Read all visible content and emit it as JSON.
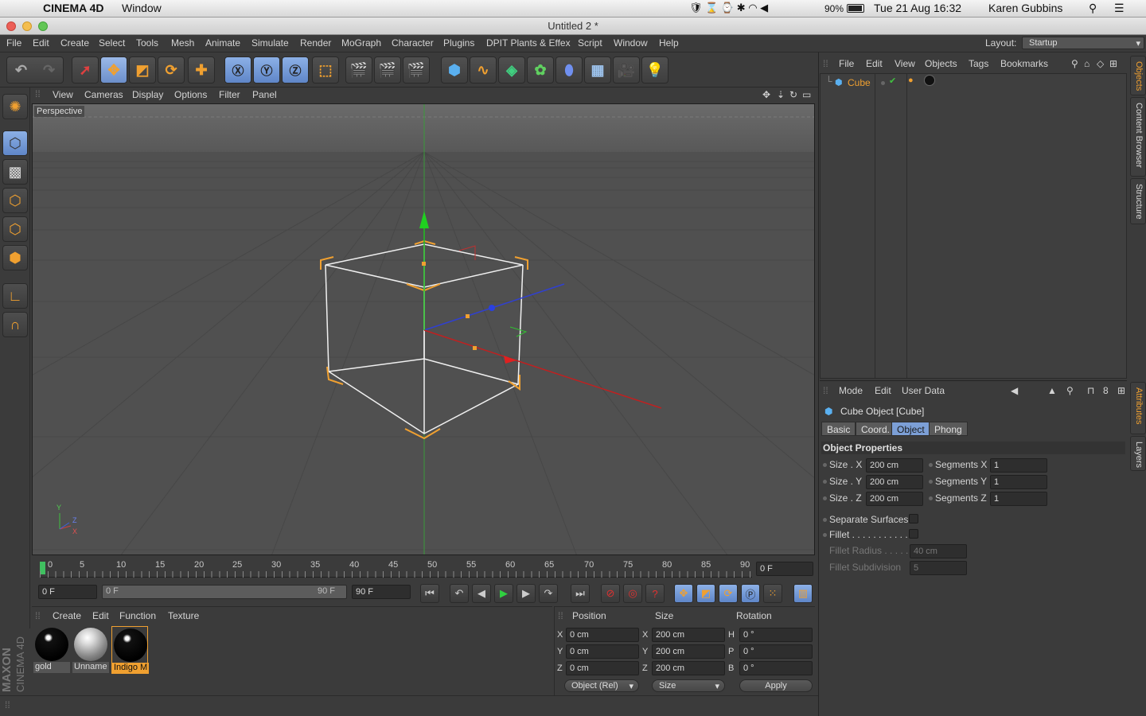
{
  "mac": {
    "app": "CINEMA 4D",
    "window_menu": "Window",
    "battery": "90%",
    "datetime": "Tue 21 Aug  16:32",
    "user": "Karen Gubbins"
  },
  "window": {
    "title": "Untitled 2 *"
  },
  "menus": [
    "File",
    "Edit",
    "Create",
    "Select",
    "Tools",
    "Mesh",
    "Animate",
    "Simulate",
    "Render",
    "MoGraph",
    "Character",
    "Plugins",
    "DPIT Plants & Effex",
    "Script",
    "Window",
    "Help"
  ],
  "layout": {
    "label": "Layout:",
    "value": "Startup"
  },
  "viewport": {
    "menus": [
      "View",
      "Cameras",
      "Display",
      "Options",
      "Filter",
      "Panel"
    ],
    "label": "Perspective",
    "axis_y": "Y",
    "axis_z": "Z",
    "axis_x": "X"
  },
  "timeline": {
    "ticks": [
      "0",
      "5",
      "10",
      "15",
      "20",
      "25",
      "30",
      "35",
      "40",
      "45",
      "50",
      "55",
      "60",
      "65",
      "70",
      "75",
      "80",
      "85",
      "90"
    ],
    "current": "0 F",
    "start": "0 F",
    "range_start": "0 F",
    "range_end": "90 F",
    "end": "90 F"
  },
  "materials": {
    "menus": [
      "Create",
      "Edit",
      "Function",
      "Texture"
    ],
    "items": [
      {
        "name": "gold"
      },
      {
        "name": "Unname"
      },
      {
        "name": "Indigo M"
      }
    ]
  },
  "coords": {
    "headers": [
      "Position",
      "Size",
      "Rotation"
    ],
    "pos": [
      {
        "axis": "X",
        "value": "0 cm"
      },
      {
        "axis": "Y",
        "value": "0 cm"
      },
      {
        "axis": "Z",
        "value": "0 cm"
      }
    ],
    "size": [
      {
        "axis": "X",
        "value": "200 cm"
      },
      {
        "axis": "Y",
        "value": "200 cm"
      },
      {
        "axis": "Z",
        "value": "200 cm"
      }
    ],
    "rot": [
      {
        "axis": "H",
        "value": "0 °"
      },
      {
        "axis": "P",
        "value": "0 °"
      },
      {
        "axis": "B",
        "value": "0 °"
      }
    ],
    "mode": "Object (Rel)",
    "sizemode": "Size",
    "apply": "Apply"
  },
  "brand": {
    "maxon": "MAXON",
    "c4d": "CINEMA 4D"
  },
  "objects": {
    "menus": [
      "File",
      "Edit",
      "View",
      "Objects",
      "Tags",
      "Bookmarks"
    ],
    "items": [
      {
        "name": "Cube"
      }
    ],
    "side_tabs": [
      "Objects",
      "Content Browser",
      "Structure"
    ]
  },
  "attributes": {
    "menus": [
      "Mode",
      "Edit",
      "User Data"
    ],
    "title": "Cube Object [Cube]",
    "tabs": [
      "Basic",
      "Coord.",
      "Object",
      "Phong"
    ],
    "active_tab": "Object",
    "section": "Object Properties",
    "props": {
      "size_x_label": "Size . X",
      "size_x": "200 cm",
      "size_y_label": "Size . Y",
      "size_y": "200 cm",
      "size_z_label": "Size . Z",
      "size_z": "200 cm",
      "seg_x_label": "Segments X",
      "seg_x": "1",
      "seg_y_label": "Segments Y",
      "seg_y": "1",
      "seg_z_label": "Segments Z",
      "seg_z": "1",
      "separate": "Separate Surfaces",
      "fillet": "Fillet . . . . . . . . . . . .",
      "fillet_radius_label": "Fillet Radius . . . . .",
      "fillet_radius": "40 cm",
      "fillet_sub_label": "Fillet Subdivision",
      "fillet_sub": "5"
    },
    "side_tabs": [
      "Attributes",
      "Layers"
    ]
  },
  "colors": {
    "accent": "#f0a030",
    "select_blue": "#7c9fd6",
    "bg": "#3b3b3b",
    "viewport": "#525252"
  }
}
